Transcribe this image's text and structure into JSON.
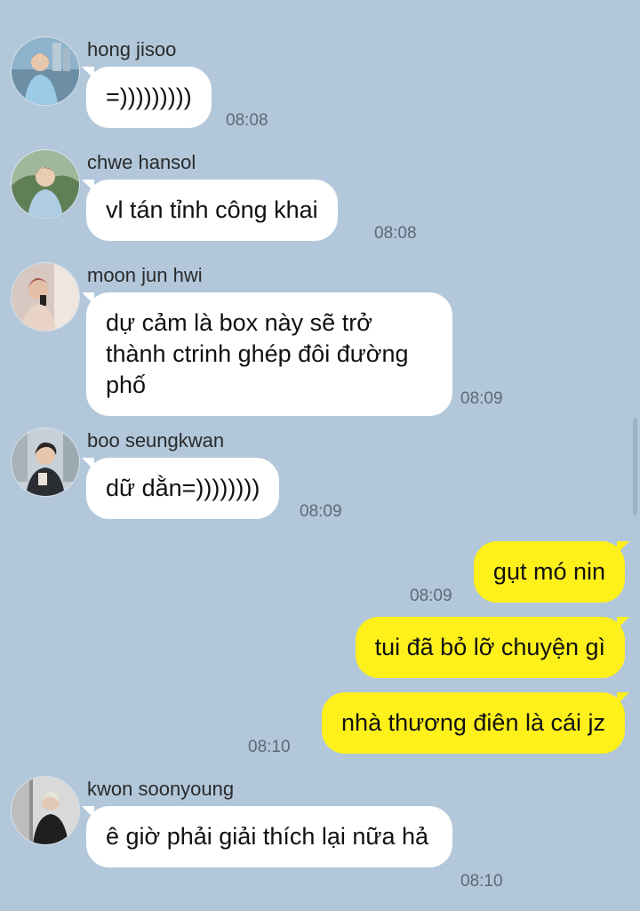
{
  "messages": [
    {
      "sender": "hong jisoo",
      "text": "=)))))))))",
      "time": "08:08",
      "avatar": "avatar-photo"
    },
    {
      "sender": "chwe hansol",
      "text": "vl tán tỉnh công khai",
      "time": "08:08",
      "avatar": "avatar-photo"
    },
    {
      "sender": "moon jun hwi",
      "text": "dự cảm là box này sẽ trở thành ctrinh ghép đôi đường phố",
      "time": "08:09",
      "avatar": "avatar-photo"
    },
    {
      "sender": "boo seungkwan",
      "text": "dữ dằn=))))))))",
      "time": "08:09",
      "avatar": "avatar-photo"
    },
    {
      "sender": "me",
      "text": "gụt mó nin",
      "time": "08:09"
    },
    {
      "sender": "me",
      "text": "tui đã bỏ lỡ chuyện gì",
      "time": ""
    },
    {
      "sender": "me",
      "text": "nhà thương điên là cái jz",
      "time": "08:10"
    },
    {
      "sender": "kwon soonyoung",
      "text": "ê giờ phải giải thích lại nữa hả",
      "time": "08:10",
      "avatar": "avatar-photo"
    }
  ],
  "colors": {
    "background": "#b2c7da",
    "incoming_bubble": "#ffffff",
    "outgoing_bubble": "#fef01b",
    "timestamp": "#5d6a75"
  }
}
